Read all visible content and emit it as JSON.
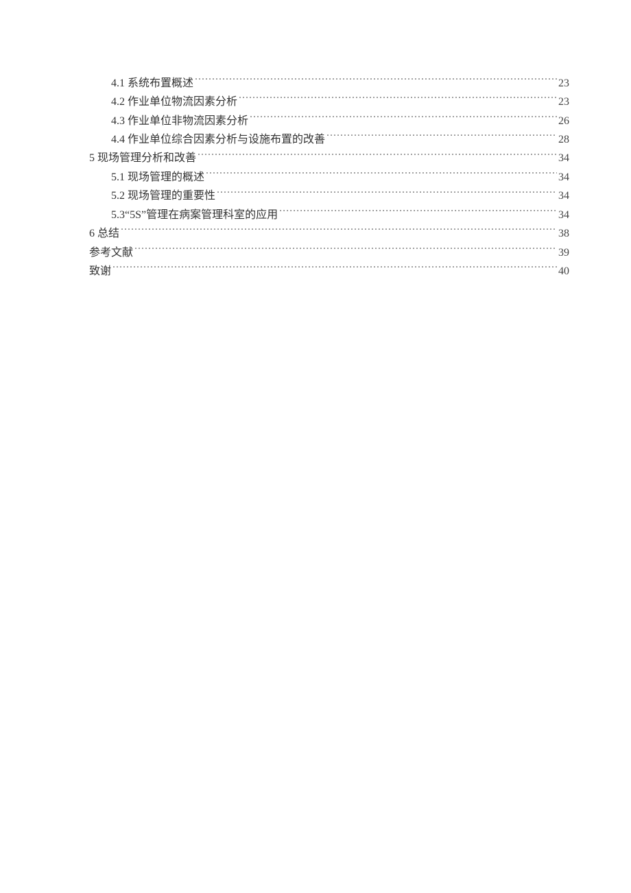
{
  "toc": [
    {
      "level": 2,
      "label": "4.1 系统布置概述",
      "page": "23"
    },
    {
      "level": 2,
      "label": "4.2 作业单位物流因素分析",
      "page": "23"
    },
    {
      "level": 2,
      "label": "4.3 作业单位非物流因素分析",
      "page": "26"
    },
    {
      "level": 2,
      "label": "4.4 作业单位综合因素分析与设施布置的改善",
      "page": "28"
    },
    {
      "level": 1,
      "label": "5 现场管理分析和改善",
      "page": "34"
    },
    {
      "level": 2,
      "label": "5.1 现场管理的概述",
      "page": "34"
    },
    {
      "level": 2,
      "label": "5.2 现场管理的重要性",
      "page": "34"
    },
    {
      "level": 2,
      "label": "5.3“5S”管理在病案管理科室的应用",
      "page": "34"
    },
    {
      "level": 1,
      "label": "6  总结",
      "page": "38"
    },
    {
      "level": 1,
      "label": "参考文献",
      "page": "39"
    },
    {
      "level": 1,
      "label": "致谢",
      "page": "40"
    }
  ]
}
